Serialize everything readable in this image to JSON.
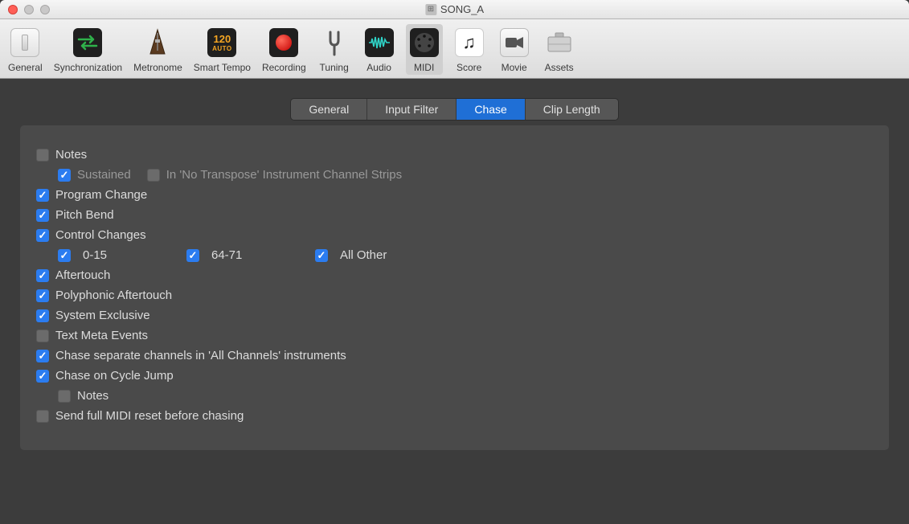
{
  "window": {
    "title": "SONG_A"
  },
  "toolbar": {
    "items": [
      {
        "id": "general",
        "label": "General"
      },
      {
        "id": "sync",
        "label": "Synchronization"
      },
      {
        "id": "metronome",
        "label": "Metronome"
      },
      {
        "id": "smart-tempo",
        "label": "Smart Tempo",
        "badge": "120",
        "badge2": "AUTO"
      },
      {
        "id": "recording",
        "label": "Recording"
      },
      {
        "id": "tuning",
        "label": "Tuning"
      },
      {
        "id": "audio",
        "label": "Audio"
      },
      {
        "id": "midi",
        "label": "MIDI"
      },
      {
        "id": "score",
        "label": "Score"
      },
      {
        "id": "movie",
        "label": "Movie"
      },
      {
        "id": "assets",
        "label": "Assets"
      }
    ],
    "selected": "midi"
  },
  "subtabs": {
    "items": [
      {
        "id": "general",
        "label": "General"
      },
      {
        "id": "input-filter",
        "label": "Input Filter"
      },
      {
        "id": "chase",
        "label": "Chase"
      },
      {
        "id": "clip-length",
        "label": "Clip Length"
      }
    ],
    "active": "chase"
  },
  "chase": {
    "notes": {
      "label": "Notes",
      "checked": false
    },
    "sustained": {
      "label": "Sustained",
      "checked": true,
      "dimmed": true
    },
    "no_transpose": {
      "label": "In 'No Transpose' Instrument Channel Strips",
      "checked": false,
      "dimmed": true
    },
    "program_change": {
      "label": "Program Change",
      "checked": true
    },
    "pitch_bend": {
      "label": "Pitch Bend",
      "checked": true
    },
    "control_changes": {
      "label": "Control Changes",
      "checked": true
    },
    "cc_0_15": {
      "label": "0-15",
      "checked": true
    },
    "cc_64_71": {
      "label": "64-71",
      "checked": true
    },
    "cc_all_other": {
      "label": "All Other",
      "checked": true
    },
    "aftertouch": {
      "label": "Aftertouch",
      "checked": true
    },
    "poly_aftertouch": {
      "label": "Polyphonic Aftertouch",
      "checked": true
    },
    "sysex": {
      "label": "System Exclusive",
      "checked": true
    },
    "text_meta": {
      "label": "Text Meta Events",
      "checked": false
    },
    "sep_channels": {
      "label": "Chase separate channels in 'All Channels' instruments",
      "checked": true
    },
    "cycle_jump": {
      "label": "Chase on Cycle Jump",
      "checked": true
    },
    "cycle_notes": {
      "label": "Notes",
      "checked": false
    },
    "full_reset": {
      "label": "Send full MIDI reset before chasing",
      "checked": false
    }
  }
}
